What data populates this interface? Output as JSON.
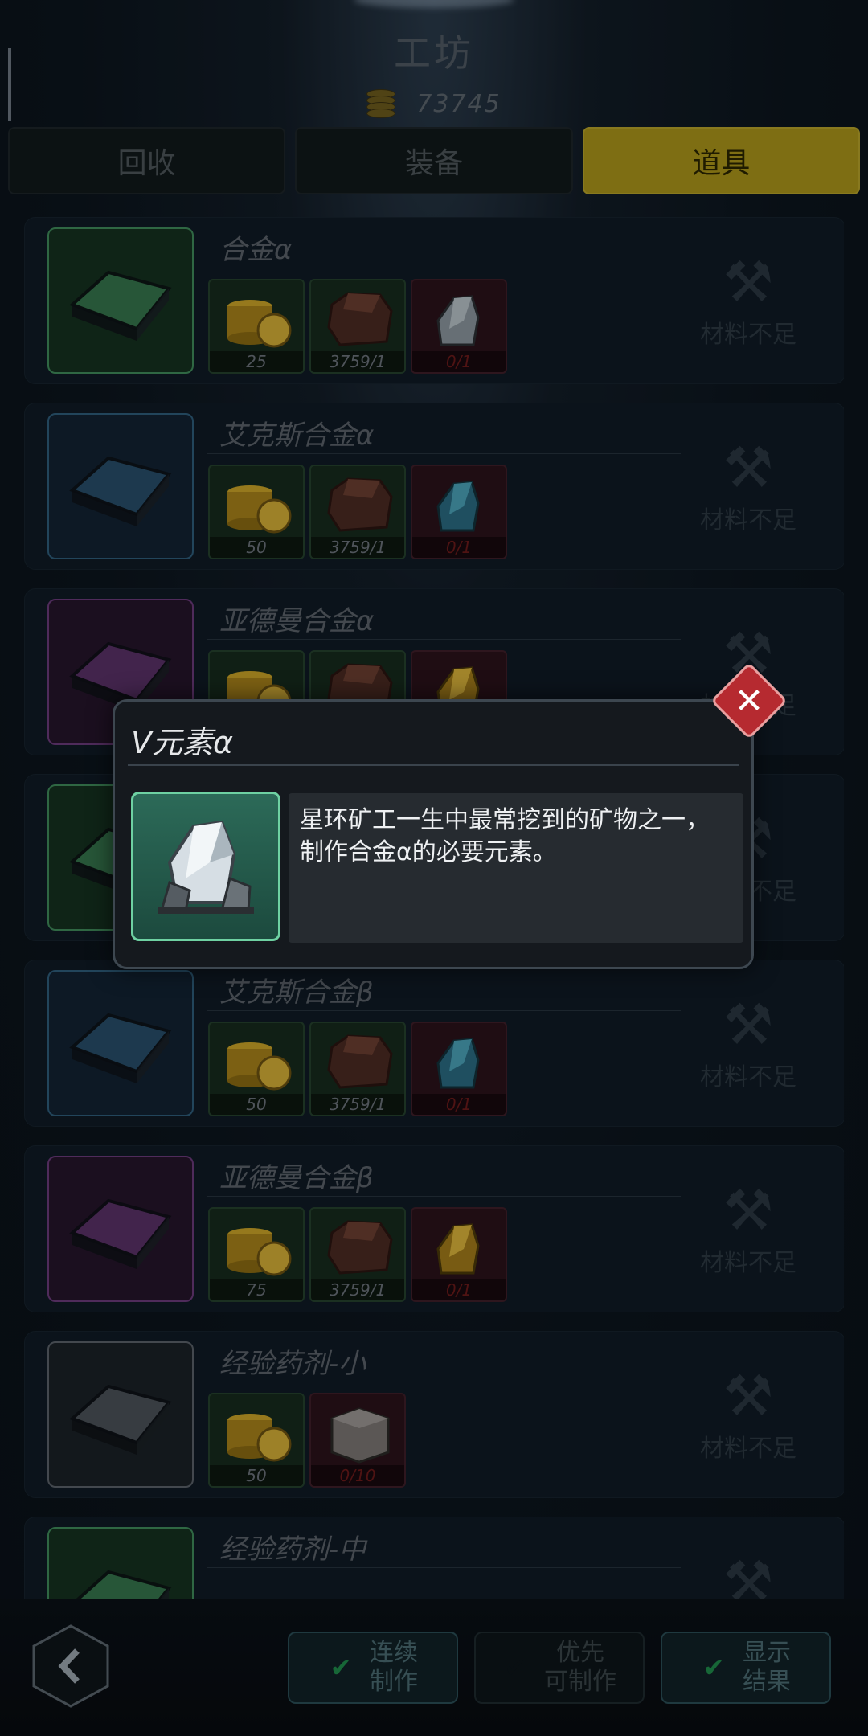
{
  "header": {
    "title": "工坊",
    "coins": "73745"
  },
  "tabs": [
    {
      "label": "回收",
      "active": false
    },
    {
      "label": "装备",
      "active": false
    },
    {
      "label": "道具",
      "active": true
    }
  ],
  "recipes": [
    {
      "name": "合金α",
      "rarity_color": "#3f8a5a",
      "thumb_bg": "#15301f",
      "status": "材料不足",
      "materials": [
        {
          "icon": "gold-coins-icon",
          "count": "25",
          "short": false
        },
        {
          "icon": "brown-ore-icon",
          "count": "3759/1",
          "short": false
        },
        {
          "icon": "silver-crystal-icon",
          "count": "0/1",
          "short": true
        }
      ]
    },
    {
      "name": "艾克斯合金α",
      "rarity_color": "#2e5c7a",
      "thumb_bg": "#122232",
      "status": "材料不足",
      "materials": [
        {
          "icon": "gold-coins-icon",
          "count": "50",
          "short": false
        },
        {
          "icon": "brown-ore-icon",
          "count": "3759/1",
          "short": false
        },
        {
          "icon": "blue-crystal-icon",
          "count": "0/1",
          "short": true
        }
      ]
    },
    {
      "name": "亚德曼合金α",
      "rarity_color": "#6a3a7a",
      "thumb_bg": "#24142a",
      "status": "材料不足",
      "materials": [
        {
          "icon": "gold-coins-icon",
          "count": "",
          "short": false
        },
        {
          "icon": "brown-ore-icon",
          "count": "",
          "short": false
        },
        {
          "icon": "gold-crystal-icon",
          "count": "",
          "short": true
        }
      ]
    },
    {
      "name": "",
      "rarity_color": "#3f8a5a",
      "thumb_bg": "#15301f",
      "status": "材料不足",
      "materials": []
    },
    {
      "name": "艾克斯合金β",
      "rarity_color": "#2e5c7a",
      "thumb_bg": "#122232",
      "status": "材料不足",
      "materials": [
        {
          "icon": "gold-coins-icon",
          "count": "50",
          "short": false
        },
        {
          "icon": "brown-ore-icon",
          "count": "3759/1",
          "short": false
        },
        {
          "icon": "blue-crystal-icon",
          "count": "0/1",
          "short": true
        }
      ]
    },
    {
      "name": "亚德曼合金β",
      "rarity_color": "#6a3a7a",
      "thumb_bg": "#24142a",
      "status": "材料不足",
      "materials": [
        {
          "icon": "gold-coins-icon",
          "count": "75",
          "short": false
        },
        {
          "icon": "brown-ore-icon",
          "count": "3759/1",
          "short": false
        },
        {
          "icon": "gold-crystal-icon",
          "count": "0/1",
          "short": true
        }
      ]
    },
    {
      "name": "经验药剂-小",
      "rarity_color": "#5a6168",
      "thumb_bg": "#1a2026",
      "status": "材料不足",
      "materials": [
        {
          "icon": "gold-coins-icon",
          "count": "50",
          "short": false
        },
        {
          "icon": "white-cube-icon",
          "count": "0/10",
          "short": true
        }
      ]
    },
    {
      "name": "经验药剂-中",
      "rarity_color": "#3f8a5a",
      "thumb_bg": "#15301f",
      "status": "",
      "materials": []
    }
  ],
  "popup": {
    "title": "V元素α",
    "description": "星环矿工一生中最常挖到的矿物之一，\n制作合金α的必要元素。",
    "icon": "silver-crystal-icon"
  },
  "bottom": {
    "back_icon": "chevron-left-icon",
    "buttons": [
      {
        "label": "连续\n制作",
        "checked": true
      },
      {
        "label": "优先\n可制作",
        "checked": false
      },
      {
        "label": "显示\n结果",
        "checked": true
      }
    ]
  }
}
